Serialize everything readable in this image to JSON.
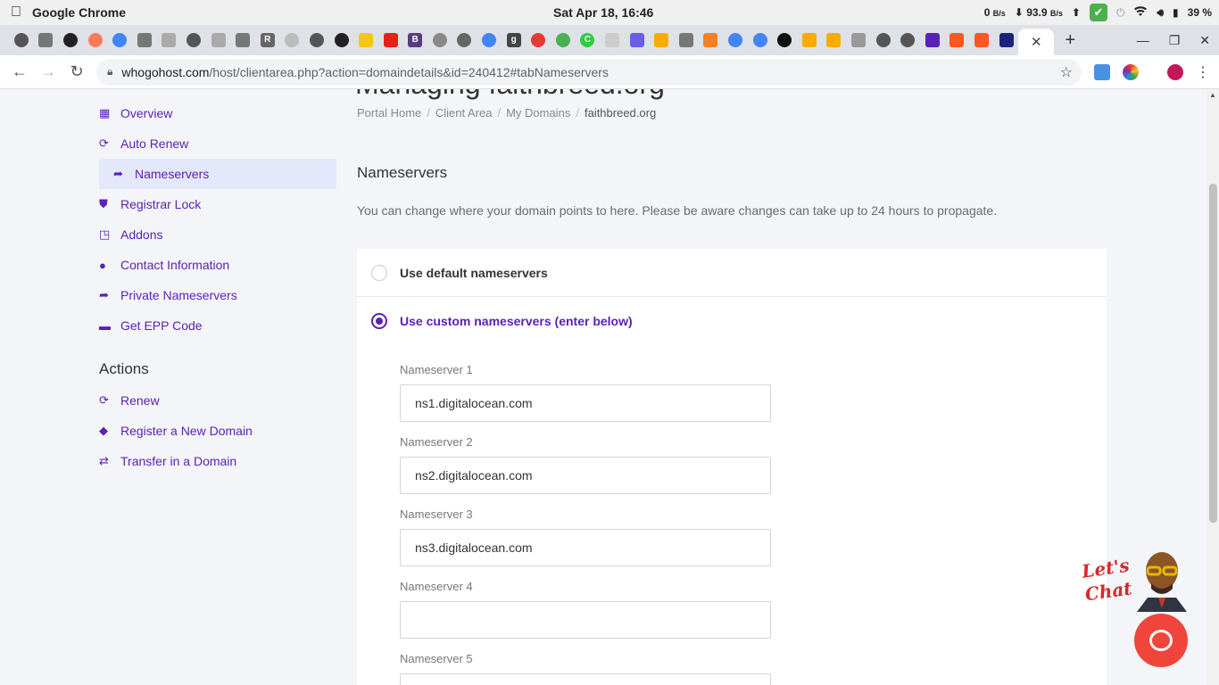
{
  "os": {
    "app_name": "Google Chrome",
    "clock": "Sat Apr 18, 16:46",
    "net_up": "0",
    "net_up_unit": "B/s",
    "net_down": "93.9",
    "net_down_unit": "B/s",
    "battery": "39 %"
  },
  "browser": {
    "url_host": "whogohost.com",
    "url_path": "/host/clientarea.php?action=domaindetails&id=240412#tabNameservers",
    "active_tab_close": "✕"
  },
  "page": {
    "heading_partial": "Managing faithbreed.org",
    "breadcrumb": [
      "Portal Home",
      "Client Area",
      "My Domains",
      "faithbreed.org"
    ],
    "sidebar": {
      "items": [
        {
          "label": "Overview",
          "icon": "grid-icon"
        },
        {
          "label": "Auto Renew",
          "icon": "sync-icon"
        },
        {
          "label": "Nameservers",
          "icon": "share-icon",
          "active": true
        },
        {
          "label": "Registrar Lock",
          "icon": "shield-icon"
        },
        {
          "label": "Addons",
          "icon": "cubes-icon"
        },
        {
          "label": "Contact Information",
          "icon": "user-icon"
        },
        {
          "label": "Private Nameservers",
          "icon": "share-icon"
        },
        {
          "label": "Get EPP Code",
          "icon": "code-icon"
        }
      ],
      "actions_title": "Actions",
      "actions": [
        {
          "label": "Renew",
          "icon": "sync-icon"
        },
        {
          "label": "Register a New Domain",
          "icon": "tag-icon"
        },
        {
          "label": "Transfer in a Domain",
          "icon": "exchange-icon"
        }
      ]
    },
    "title": "Nameservers",
    "description": "You can change where your domain points to here. Please be aware changes can take up to 24 hours to propagate.",
    "options": {
      "default_label": "Use default nameservers",
      "custom_label": "Use custom nameservers (enter below)",
      "selected": "custom"
    },
    "nameservers": [
      {
        "label": "Nameserver 1",
        "value": "ns1.digitalocean.com"
      },
      {
        "label": "Nameserver 2",
        "value": "ns2.digitalocean.com"
      },
      {
        "label": "Nameserver 3",
        "value": "ns3.digitalocean.com"
      },
      {
        "label": "Nameserver 4",
        "value": ""
      },
      {
        "label": "Nameserver 5",
        "value": ""
      }
    ],
    "chat": {
      "line1": "Let's",
      "line2": "Chat"
    }
  },
  "colors": {
    "accent": "#5b21b6",
    "chat_red": "#f0453a"
  }
}
